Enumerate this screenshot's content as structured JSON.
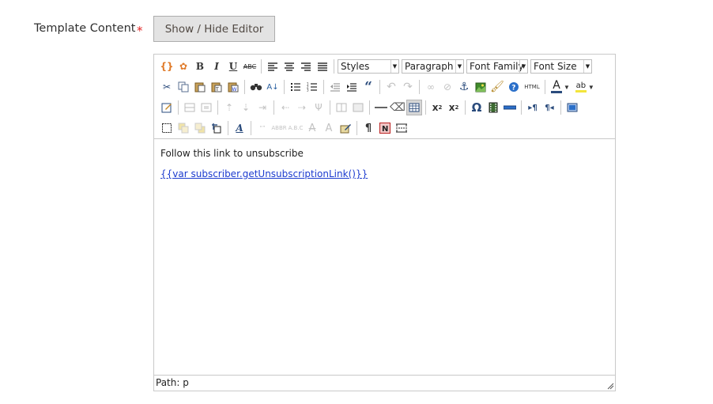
{
  "field": {
    "label": "Template Content",
    "required_mark": "*"
  },
  "toggle_button": {
    "label": "Show / Hide Editor"
  },
  "toolbar": {
    "styles_select": "Styles",
    "format_select": "Paragraph",
    "font_family_select": "Font Family",
    "font_size_select": "Font Size",
    "bold": "B",
    "italic": "I",
    "underline": "U",
    "strike": "ABC",
    "html": "HTML",
    "omega": "Ω",
    "quote": "“"
  },
  "content": {
    "paragraph": "Follow this link to unsubscribe",
    "link": "{{var subscriber.getUnsubscriptionLink()}}"
  },
  "status": {
    "path": "Path: p"
  }
}
